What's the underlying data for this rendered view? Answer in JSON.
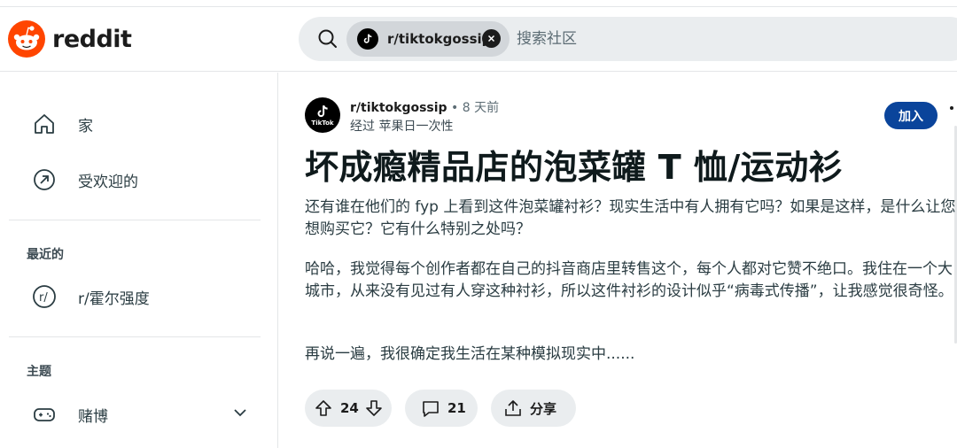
{
  "app": {
    "logo_text": "reddit",
    "brand_color": "#ff4500"
  },
  "search": {
    "chip_label": "r/tiktokgossip",
    "placeholder": "搜索社区"
  },
  "sidebar": {
    "items": [
      {
        "label": "家",
        "icon": "home-icon"
      },
      {
        "label": "受欢迎的",
        "icon": "popular-icon"
      }
    ],
    "recent_title": "最近的",
    "recent_items": [
      {
        "label": "r/霍尔强度",
        "icon": "subreddit-icon"
      }
    ],
    "topics_title": "主题",
    "topic_items": [
      {
        "label": "赌博",
        "icon": "gamepad-icon"
      }
    ]
  },
  "post": {
    "subreddit": "r/tiktokgossip",
    "time": "• 8 天前",
    "author_line": "经过 苹果日一次性",
    "avatar_text": "TikTok",
    "join_label": "加入",
    "title": "坏成瘾精品店的泡菜罐 T 恤/运动衫",
    "paragraphs": [
      "还有谁在他们的 fyp 上看到这件泡菜罐衬衫？现实生活中有人拥有它吗？如果是这样，是什么让您想购买它？它有什么特别之处吗？",
      "哈哈，我觉得每个创作者都在自己的抖音商店里转售这个，每个人都对它赞不绝口。我住在一个大城市，从来没有见过有人穿这种衬衫，所以这件衬衫的设计似乎“病毒式传播”，让我感觉很奇怪。",
      "再说一遍，我很确定我生活在某种模拟现实中......"
    ],
    "votes": "24",
    "comments": "21",
    "share_label": "分享"
  }
}
